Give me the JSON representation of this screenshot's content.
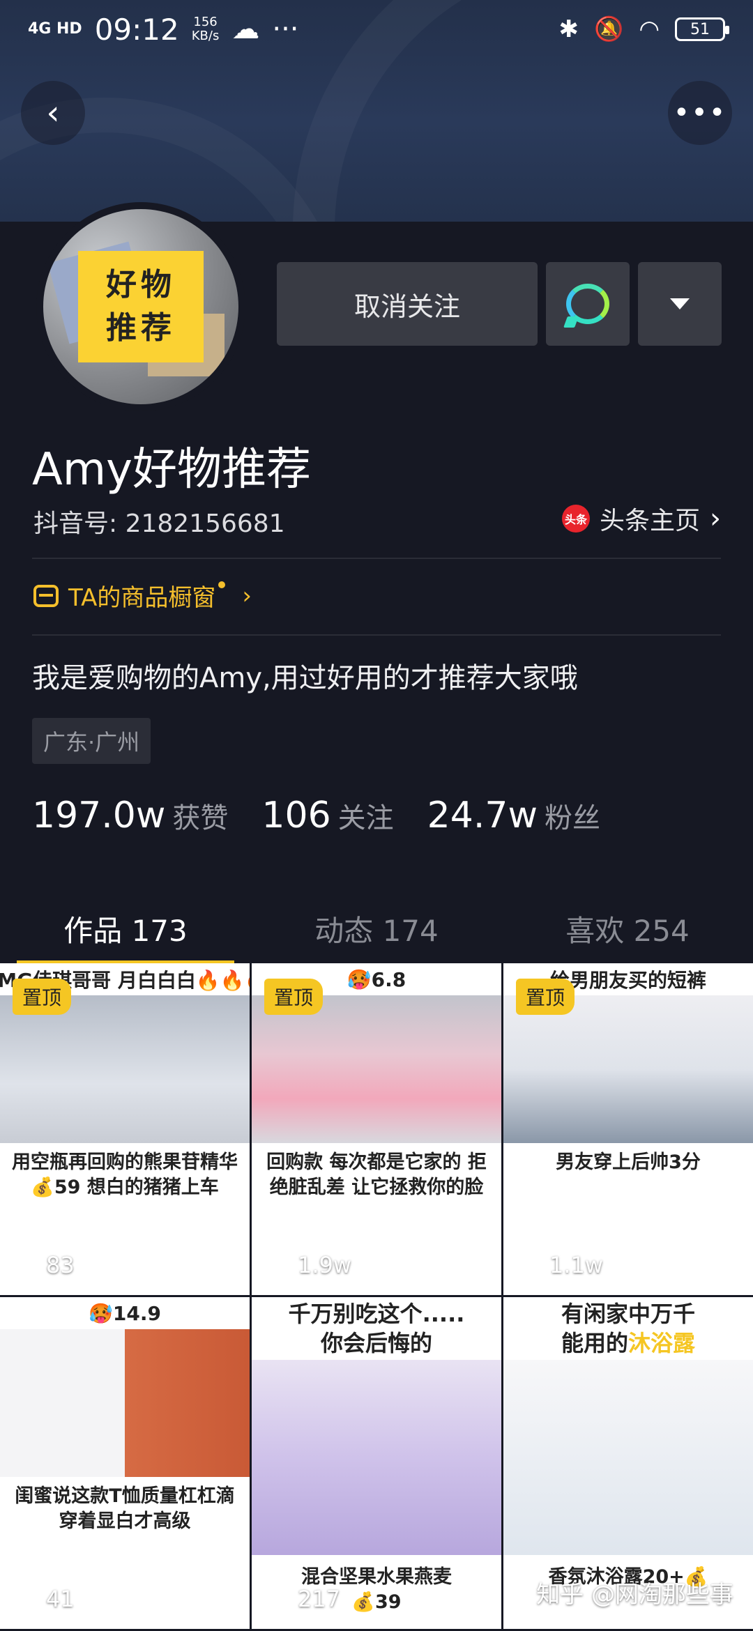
{
  "status_bar": {
    "network": "4G HD",
    "time": "09:12",
    "speed_value": "156",
    "speed_unit": "KB/s",
    "more": "···",
    "battery": "51"
  },
  "header": {
    "back_icon": "chevron-left-icon",
    "more_icon": "more-dots-icon"
  },
  "avatar": {
    "line1": "好物",
    "line2": "推荐"
  },
  "actions": {
    "unfollow_label": "取消关注",
    "message_icon": "chat-bubble-icon",
    "dropdown_icon": "caret-down-icon"
  },
  "profile": {
    "username": "Amy好物推荐",
    "douyin_id": "抖音号: 2182156681",
    "toutiao_badge": "头条",
    "toutiao_label": "头条主页",
    "shop_label": "TA的商品橱窗",
    "bio": "我是爱购物的Amy,用过好用的才推荐大家哦",
    "location": "广东·广州"
  },
  "stats": [
    {
      "num": "197.0w",
      "label": "获赞"
    },
    {
      "num": "106",
      "label": "关注"
    },
    {
      "num": "24.7w",
      "label": "粉丝"
    }
  ],
  "tabs": [
    {
      "label": "作品 173"
    },
    {
      "label": "动态 174"
    },
    {
      "label": "喜欢 254"
    }
  ],
  "colors": {
    "background": "#161823",
    "accent_yellow": "#f5c623",
    "button_bg": "#393b44"
  },
  "videos": [
    {
      "top": "OMG佳琪哥哥 月白白白🔥🔥🔥",
      "pin": "置顶",
      "caption": "用空瓶再回购的熊果苷精华 💰59 想白的猪猪上车",
      "likes": "83"
    },
    {
      "top": "🥵6.8",
      "pin": "置顶",
      "caption": "回购款 每次都是它家的 拒绝脏乱差 让它拯救你的脸",
      "likes": "1.9w"
    },
    {
      "top": "给男朋友买的短裤",
      "pin": "置顶",
      "caption": "男友穿上后帅3分",
      "likes": "1.1w"
    },
    {
      "top": "🥵14.9",
      "pin": "",
      "caption": "闺蜜说这款T恤质量杠杠滴 穿着显白才高级",
      "likes": "41"
    },
    {
      "top1": "千万别吃这个.....",
      "top2": "你会后悔的",
      "caption1": "混合坚果水果燕麦",
      "caption2": "💰39",
      "likes": "217"
    },
    {
      "top1": "有闲家中万千",
      "top2a": "能用的",
      "top2b": "沐浴露",
      "caption1": "香氛沐浴露20+💰",
      "likes": "",
      "watermark": "知乎 @网淘那些事"
    }
  ]
}
